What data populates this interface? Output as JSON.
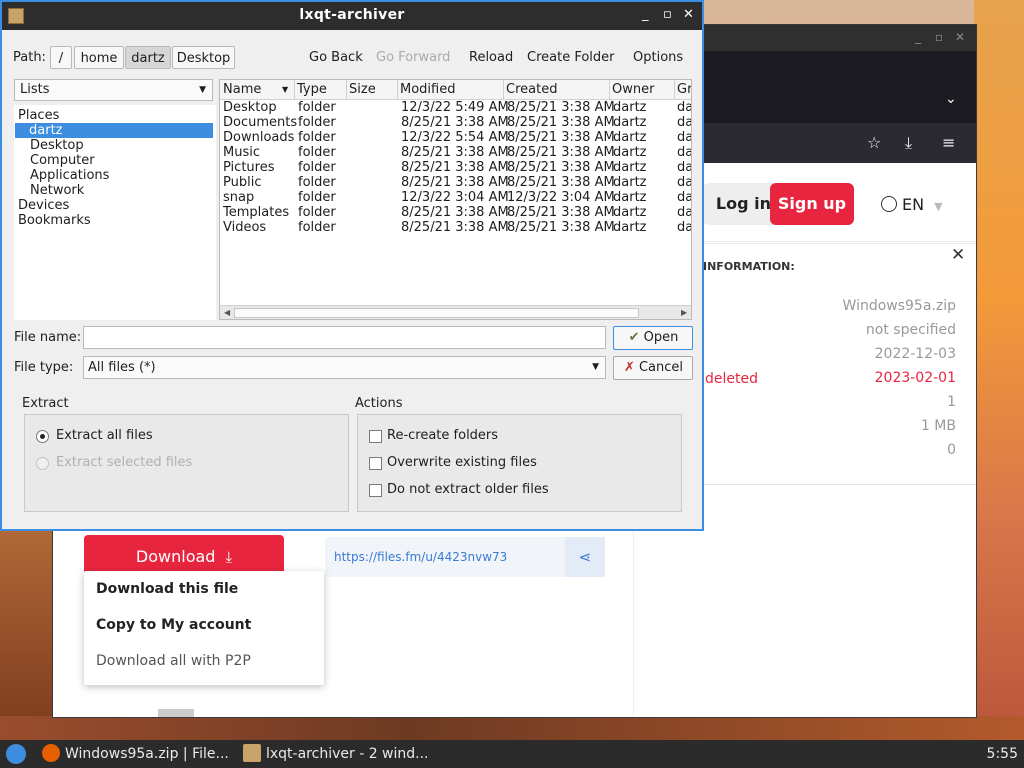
{
  "browser": {
    "login_label": "Log in",
    "signup_label": "Sign up",
    "language": "EN",
    "info_title": "INFORMATION:",
    "info_values": [
      "Windows95a.zip",
      "not specified",
      "2022-12-03",
      "2023-02-01",
      "1",
      "1 MB",
      "0"
    ],
    "deleted_label": "deleted",
    "download_label": "Download",
    "share_url": "https://files.fm/u/4423nvw73",
    "dropdown_items": [
      "Download this file",
      "Copy to My account",
      "Download all with P2P"
    ]
  },
  "archiver": {
    "title": "lxqt-archiver",
    "path_label": "Path:",
    "path_segments": [
      "/",
      "home",
      "dartz",
      "Desktop"
    ],
    "nav": {
      "back": "Go Back",
      "forward": "Go Forward",
      "reload": "Reload",
      "create_folder": "Create Folder",
      "options": "Options"
    },
    "sidebar_mode": "Lists",
    "places": [
      "Places",
      "dartz",
      "Desktop",
      "Computer",
      "Applications",
      "Network",
      "Devices",
      "Bookmarks"
    ],
    "columns": [
      "Name",
      "Type",
      "Size",
      "Modified",
      "Created",
      "Owner",
      "Gr"
    ],
    "rows": [
      {
        "name": "Desktop",
        "type": "folder",
        "modified": "12/3/22 5:49 AM",
        "created": "8/25/21 3:38 AM",
        "owner": "dartz",
        "group": "da"
      },
      {
        "name": "Documents",
        "type": "folder",
        "modified": "8/25/21 3:38 AM",
        "created": "8/25/21 3:38 AM",
        "owner": "dartz",
        "group": "da"
      },
      {
        "name": "Downloads",
        "type": "folder",
        "modified": "12/3/22 5:54 AM",
        "created": "8/25/21 3:38 AM",
        "owner": "dartz",
        "group": "da"
      },
      {
        "name": "Music",
        "type": "folder",
        "modified": "8/25/21 3:38 AM",
        "created": "8/25/21 3:38 AM",
        "owner": "dartz",
        "group": "da"
      },
      {
        "name": "Pictures",
        "type": "folder",
        "modified": "8/25/21 3:38 AM",
        "created": "8/25/21 3:38 AM",
        "owner": "dartz",
        "group": "da"
      },
      {
        "name": "Public",
        "type": "folder",
        "modified": "8/25/21 3:38 AM",
        "created": "8/25/21 3:38 AM",
        "owner": "dartz",
        "group": "da"
      },
      {
        "name": "snap",
        "type": "folder",
        "modified": "12/3/22 3:04 AM",
        "created": "12/3/22 3:04 AM",
        "owner": "dartz",
        "group": "da"
      },
      {
        "name": "Templates",
        "type": "folder",
        "modified": "8/25/21 3:38 AM",
        "created": "8/25/21 3:38 AM",
        "owner": "dartz",
        "group": "da"
      },
      {
        "name": "Videos",
        "type": "folder",
        "modified": "8/25/21 3:38 AM",
        "created": "8/25/21 3:38 AM",
        "owner": "dartz",
        "group": "da"
      }
    ],
    "file_name_label": "File name:",
    "file_name_value": "",
    "file_type_label": "File type:",
    "file_type_value": "All files (*)",
    "open_label": "Open",
    "cancel_label": "Cancel",
    "extract_title": "Extract",
    "extract_all_label": "Extract all files",
    "extract_selected_label": "Extract selected files",
    "actions_title": "Actions",
    "actions": [
      "Re-create folders",
      "Overwrite existing files",
      "Do not extract older files"
    ]
  },
  "taskbar": {
    "tasks": [
      "Windows95a.zip | File...",
      "lxqt-archiver - 2 wind..."
    ],
    "clock": "5:55"
  },
  "colors": {
    "accent": "#3d8ee0",
    "brand_red": "#e8253f",
    "link_blue": "#3a7bd5"
  }
}
